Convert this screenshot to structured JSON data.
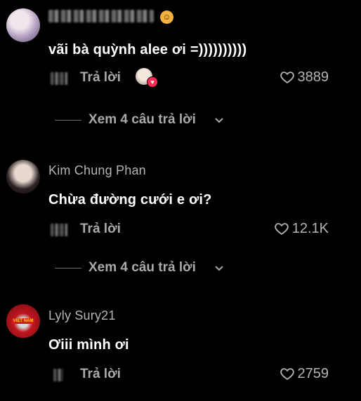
{
  "comments": [
    {
      "username": "",
      "text": "vãi bà quỳnh alee ơi =))))))))))",
      "reply_label": "Trả lời",
      "likes": "3889",
      "view_replies": "Xem 4 câu trả lời",
      "avatar_icon": "avatar-girl-icon",
      "emoji_icon": "smiling-face-icon"
    },
    {
      "username": "Kim Chung Phan",
      "text": "Chừa đường cưới e ơi?",
      "reply_label": "Trả lời",
      "likes": "12.1K",
      "view_replies": "Xem 4 câu trả lời",
      "avatar_icon": "avatar-portrait-icon"
    },
    {
      "username": "Lyly Sury21",
      "text": "Ơiii mình ơi",
      "reply_label": "Trả lời",
      "likes": "2759",
      "avatar_icon": "avatar-vietnam-icon",
      "avatar_badge": "VIET NAM"
    }
  ],
  "colors": {
    "background": "#000000",
    "muted_text": "#aaaaaa",
    "liked_badge": "#fe2c55"
  }
}
